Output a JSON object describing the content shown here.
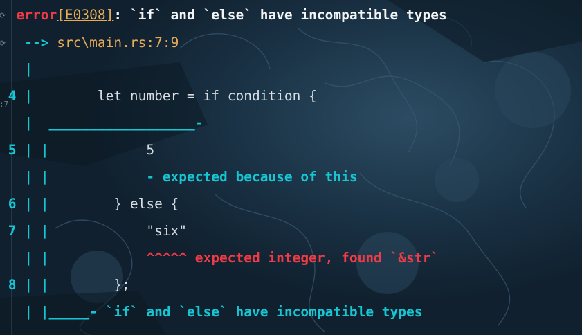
{
  "gutter": {
    "marks": [
      "⟳",
      "⟳",
      ":7"
    ]
  },
  "diagnostic": {
    "header": {
      "level": "error",
      "code": "[E0308]",
      "message": ": `if` and `else` have incompatible types"
    },
    "location": {
      "arrow": "-->",
      "path": "src\\main.rs:7:9"
    },
    "lines": [
      {
        "gutter": "   |",
        "code": ""
      },
      {
        "gutter": " 4 |",
        "code": "        let number = if condition {"
      },
      {
        "gutter": "   |",
        "underline": "  __________________-"
      },
      {
        "gutter": " 5 | |",
        "code": "            5"
      },
      {
        "gutter": "   | |",
        "note": "            - expected because of this"
      },
      {
        "gutter": " 6 | |",
        "code": "        } else {"
      },
      {
        "gutter": " 7 | |",
        "code": "            \"six\""
      },
      {
        "gutter": "   | |",
        "error_note": "            ^^^^^ expected integer, found `&str`"
      },
      {
        "gutter": " 8 | |",
        "code": "        };"
      },
      {
        "gutter": "   | |",
        "final_note": "_____- `if` and `else` have incompatible types"
      }
    ]
  }
}
